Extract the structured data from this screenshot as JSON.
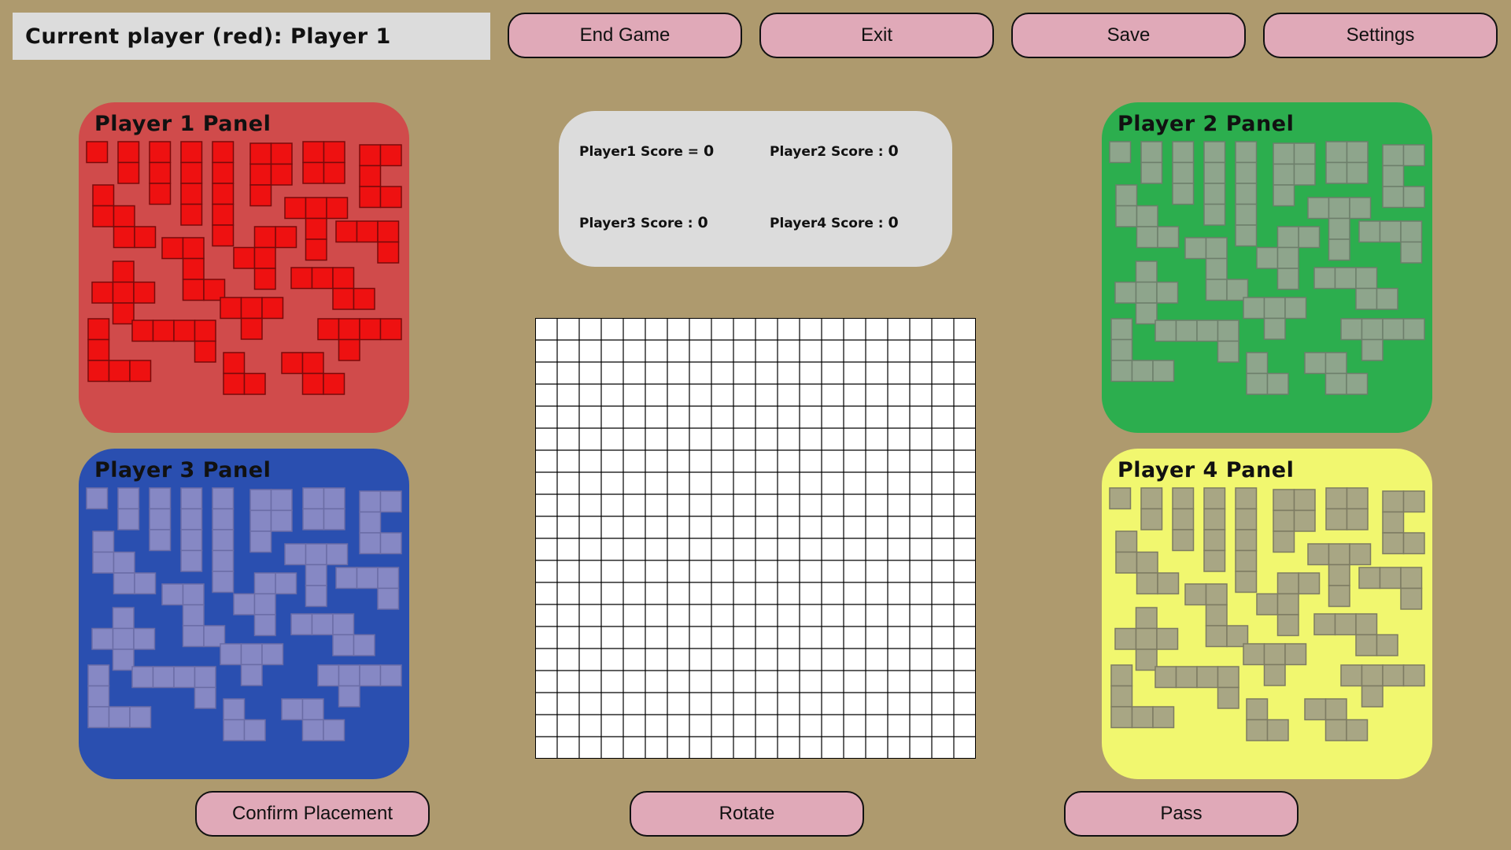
{
  "status": {
    "current_player_text": "Current player (red): Player 1"
  },
  "toolbar": {
    "end_game_label": "End Game",
    "exit_label": "Exit",
    "save_label": "Save",
    "settings_label": "Settings"
  },
  "panels": {
    "p1": {
      "title": "Player 1 Panel",
      "color": "#d04b4b",
      "piece_fill": "#ee1111",
      "piece_stroke": "#7a0a0a"
    },
    "p2": {
      "title": "Player 2 Panel",
      "color": "#2cae4e",
      "piece_fill": "#8ea58c",
      "piece_stroke": "#6d7f6b"
    },
    "p3": {
      "title": "Player 3 Panel",
      "color": "#2a4fb0",
      "piece_fill": "#8688c4",
      "piece_stroke": "#6a6ca6"
    },
    "p4": {
      "title": "Player 4 Panel",
      "color": "#f1f76f",
      "piece_fill": "#a8a684",
      "piece_stroke": "#7d7b62"
    }
  },
  "scores": {
    "p1_label": "Player1 Score =",
    "p1_value": "0",
    "p2_label": "Player2 Score :",
    "p2_value": "0",
    "p3_label": "Player3 Score :",
    "p3_value": "0",
    "p4_label": "Player4 Score :",
    "p4_value": "0"
  },
  "board": {
    "columns": 20,
    "rows": 20
  },
  "actions": {
    "confirm_label": "Confirm Placement",
    "rotate_label": "Rotate",
    "pass_label": "Pass"
  }
}
